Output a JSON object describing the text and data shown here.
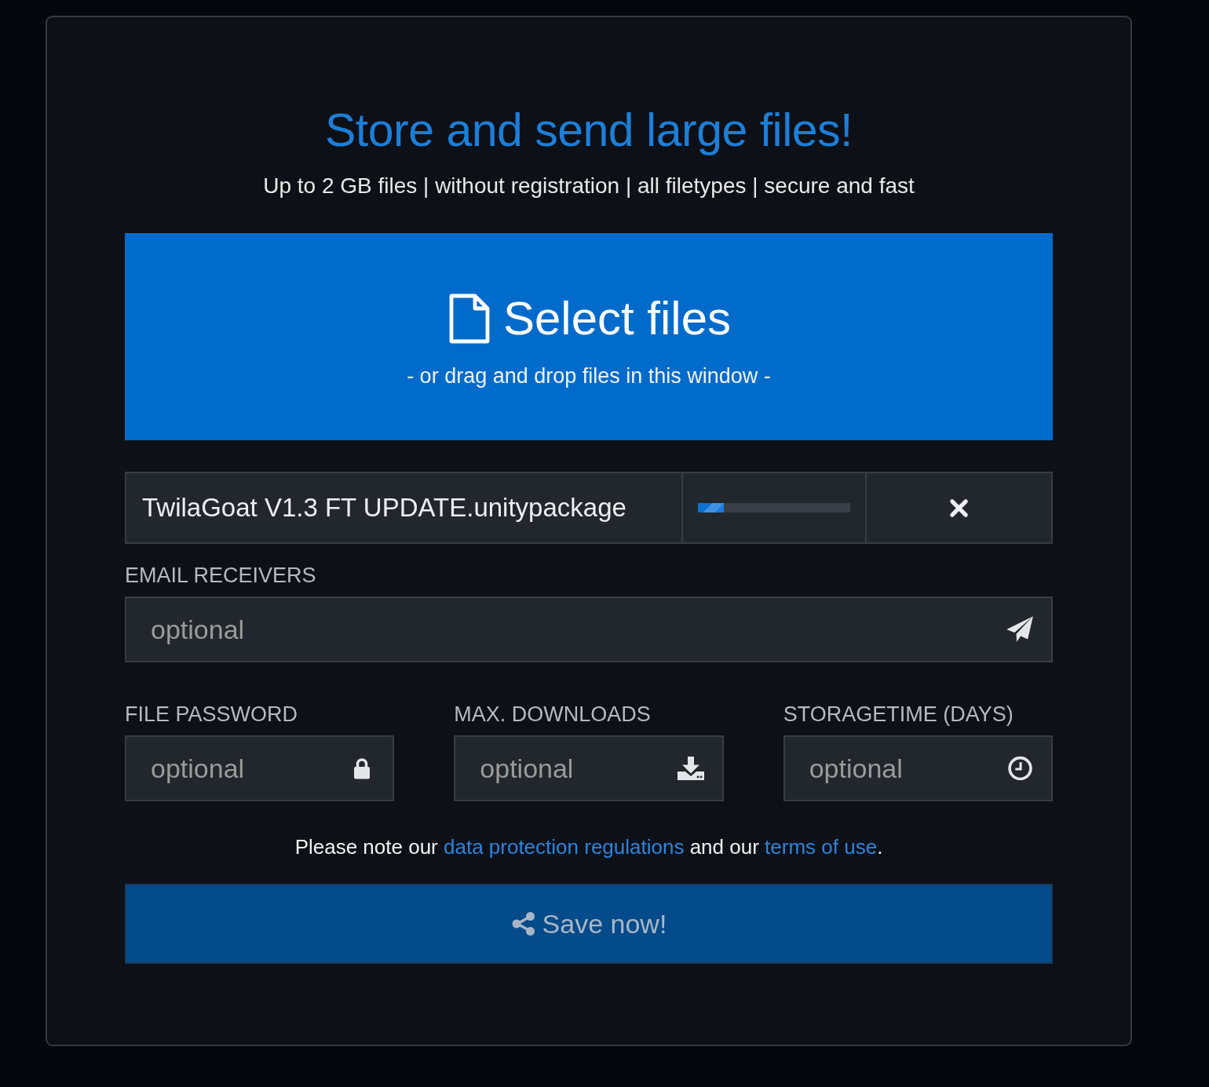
{
  "header": {
    "title": "Store and send large files!",
    "subtitle": "Up to 2 GB files | without registration | all filetypes | secure and fast"
  },
  "dropzone": {
    "label": "Select files",
    "hint": "- or drag and drop files in this window -"
  },
  "files": [
    {
      "name": "TwilaGoat V1.3 FT UPDATE.unitypackage",
      "level": 0.17
    }
  ],
  "email": {
    "label": "EMAIL RECEIVERS",
    "placeholder": "optional"
  },
  "options": [
    {
      "label": "FILE PASSWORD",
      "placeholder": "optional",
      "kind": "password"
    },
    {
      "label": "MAX. DOWNLOADS",
      "placeholder": "optional",
      "kind": "downloads"
    },
    {
      "label": "STORAGETIME (DAYS)",
      "placeholder": "optional",
      "kind": "days"
    }
  ],
  "note": [
    {
      "kind": "text",
      "text": "Please note our "
    },
    {
      "kind": "link",
      "text": "data protection regulations"
    },
    {
      "kind": "text",
      "text": " and our "
    },
    {
      "kind": "link",
      "text": "terms of use"
    },
    {
      "kind": "text",
      "text": "."
    }
  ],
  "save_button": {
    "label": "Save now!",
    "disabled": true
  }
}
